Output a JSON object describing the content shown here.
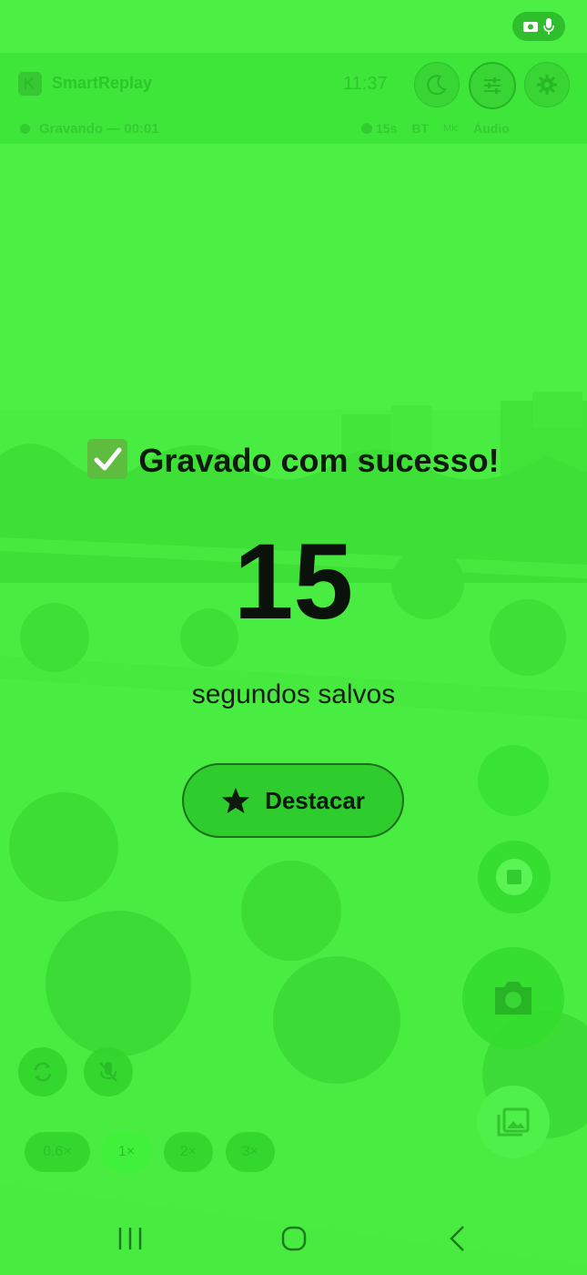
{
  "app": {
    "title": "SmartReplay",
    "clock": "11:37"
  },
  "recording": {
    "status": "Gravando — 00:01",
    "duration_tag": "15s",
    "bt": "BT",
    "mic_label": "Mic",
    "audio": "Áudio"
  },
  "message": {
    "title": "Gravado com sucesso!",
    "seconds": "15",
    "subtitle": "segundos salvos",
    "highlight_label": "Destacar"
  },
  "zoom": {
    "options": [
      "0.6×",
      "1×",
      "2×",
      "3×"
    ],
    "selected": "1×"
  },
  "icons": {
    "theme": "moon-icon",
    "filters": "sliders-icon",
    "settings": "gear-icon",
    "stop": "stop-icon",
    "camera": "camera-icon",
    "gallery": "gallery-icon",
    "flip": "flip-camera-icon",
    "mic_off": "mic-off-icon",
    "check": "check-box-icon",
    "star": "star-icon"
  },
  "colors": {
    "overlay": "#3fe63a",
    "text_dark": "#0d1a0d",
    "button_border": "#1c6e1c"
  }
}
